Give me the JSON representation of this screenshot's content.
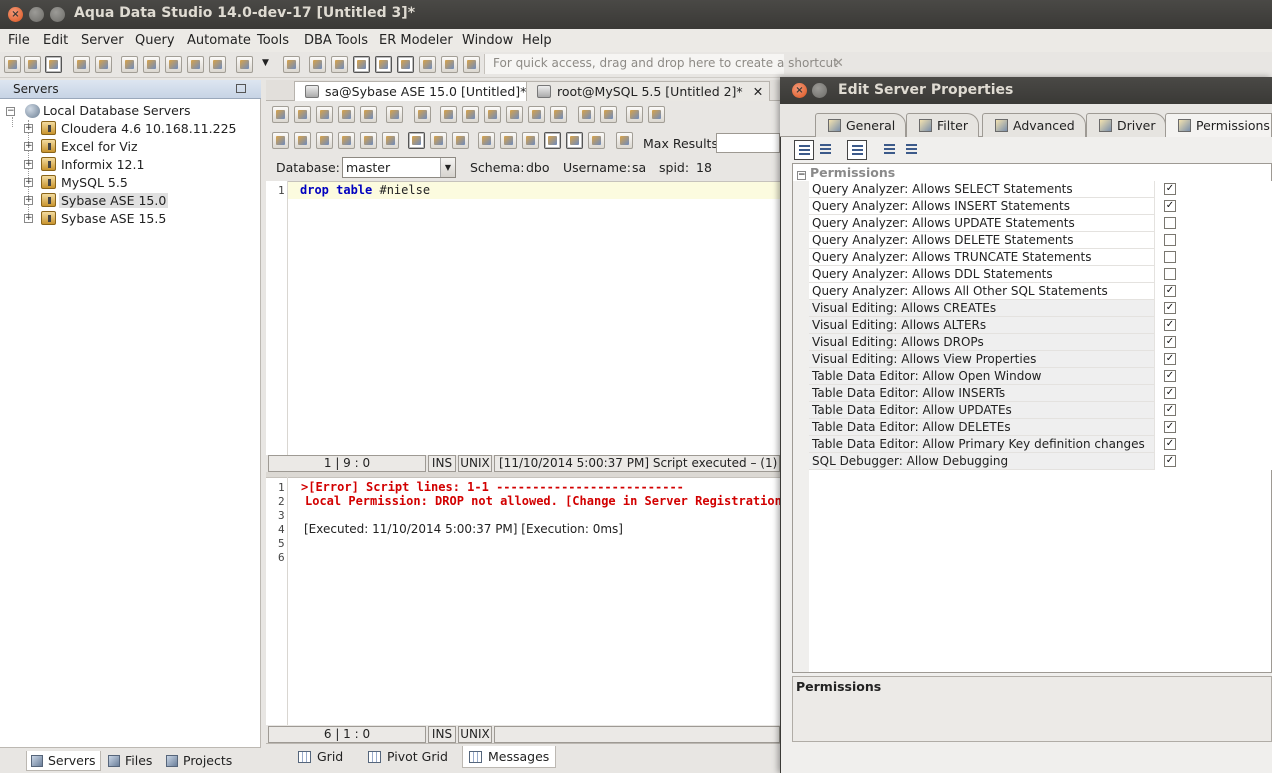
{
  "window": {
    "title": "Aqua Data Studio 14.0-dev-17 [Untitled 3]*"
  },
  "menu": [
    "File",
    "Edit",
    "Server",
    "Query",
    "Automate",
    "Tools",
    "DBA Tools",
    "ER Modeler",
    "Window",
    "Help"
  ],
  "toolbar": {
    "quick_access_placeholder": "For quick access, drag and drop here to create a shortcut"
  },
  "servers_panel": {
    "title": "Servers",
    "root": "Local Database Servers",
    "items": [
      "Cloudera 4.6 10.168.11.225",
      "Excel for Viz",
      "Informix 12.1",
      "MySQL 5.5",
      "Sybase ASE 15.0",
      "Sybase ASE 15.5"
    ],
    "selected_index": 4,
    "bottom_tabs": [
      "Servers",
      "Files",
      "Projects"
    ]
  },
  "document_tabs": [
    {
      "label": "sa@Sybase ASE 15.0 [Untitled]*",
      "close": ""
    },
    {
      "label": "root@MySQL 5.5 [Untitled 2]*",
      "close": "✕"
    }
  ],
  "query": {
    "max_results_label": "Max Results:",
    "database_label": "Database:",
    "database_value": "master",
    "schema_label": "Schema:",
    "schema_value": "dbo",
    "username_label": "Username:",
    "username_value": "sa",
    "spid_label": "spid:",
    "spid_value": "18",
    "code_keyword": "drop table",
    "code_rest": " #nielse",
    "editor_line_numbers": [
      "1"
    ]
  },
  "editor_status": {
    "position": "1 | 9 : 0",
    "mode": "INS",
    "eol": "UNIX",
    "message": "[11/10/2014 5:00:37 PM] Script executed – (1)"
  },
  "results": {
    "line_numbers": [
      "1",
      "2",
      "3",
      "4",
      "5",
      "6"
    ],
    "error_line": ">[Error] Script lines: 1-1 --------------------------",
    "permission_line": "Local Permission: DROP not allowed. [Change in Server Registration->P",
    "executed_line": "[Executed: 11/10/2014 5:00:37 PM] [Execution: 0ms]"
  },
  "results_status": {
    "position": "6 | 1 : 0",
    "mode": "INS",
    "eol": "UNIX"
  },
  "result_tabs": [
    "Grid",
    "Pivot Grid",
    "Messages"
  ],
  "dialog": {
    "title": "Edit Server Properties",
    "tabs": [
      "General",
      "Filter",
      "Advanced",
      "Driver",
      "Permissions"
    ],
    "group": "Permissions",
    "permissions": [
      {
        "label": "Query Analyzer: Allows SELECT Statements",
        "checked": true
      },
      {
        "label": "Query Analyzer: Allows INSERT Statements",
        "checked": true
      },
      {
        "label": "Query Analyzer: Allows UPDATE Statements",
        "checked": false
      },
      {
        "label": "Query Analyzer: Allows DELETE Statements",
        "checked": false
      },
      {
        "label": "Query Analyzer: Allows TRUNCATE Statements",
        "checked": false
      },
      {
        "label": "Query Analyzer: Allows DDL Statements",
        "checked": false
      },
      {
        "label": "Query Analyzer: Allows All Other SQL Statements",
        "checked": true
      },
      {
        "label": "Visual Editing: Allows CREATEs",
        "checked": true
      },
      {
        "label": "Visual Editing: Allows ALTERs",
        "checked": true
      },
      {
        "label": "Visual Editing: Allows DROPs",
        "checked": true
      },
      {
        "label": "Visual Editing: Allows View Properties",
        "checked": true
      },
      {
        "label": "Table Data Editor: Allow Open Window",
        "checked": true
      },
      {
        "label": "Table Data Editor: Allow INSERTs",
        "checked": true
      },
      {
        "label": "Table Data Editor: Allow UPDATEs",
        "checked": true
      },
      {
        "label": "Table Data Editor: Allow DELETEs",
        "checked": true
      },
      {
        "label": "Table Data Editor: Allow Primary Key definition changes",
        "checked": true
      },
      {
        "label": "SQL Debugger: Allow Debugging",
        "checked": true
      }
    ],
    "description_title": "Permissions",
    "check_glyph": "✓"
  }
}
